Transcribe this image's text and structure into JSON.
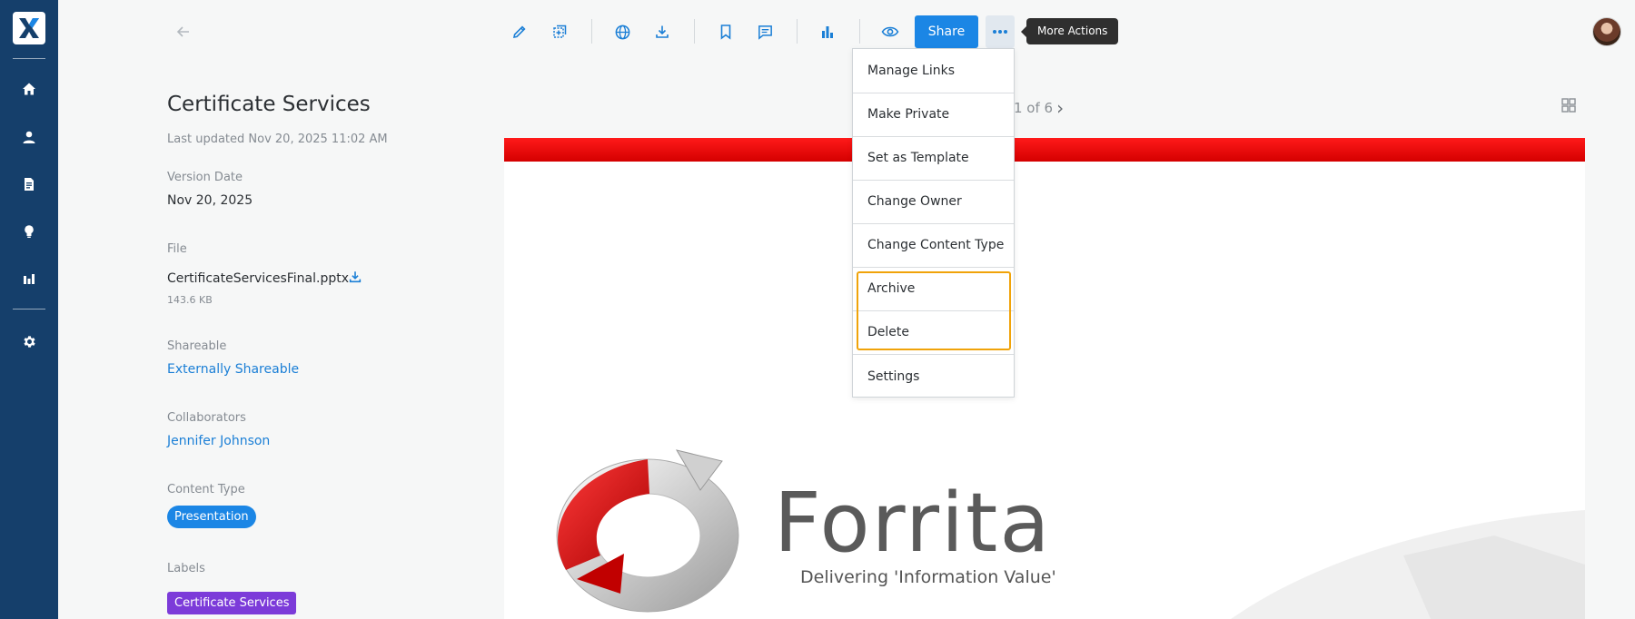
{
  "nav": {
    "logo_letter": "X",
    "items": [
      "home-icon",
      "user-icon",
      "document-icon",
      "lightbulb-icon",
      "bar-chart-icon",
      "gear-icon"
    ]
  },
  "toolbar": {
    "share_label": "Share",
    "more_tooltip": "More Actions",
    "icons": [
      "back-arrow-icon",
      "edit-icon",
      "copy-icon",
      "globe-icon",
      "download-icon",
      "bookmark-icon",
      "comment-icon",
      "stats-icon",
      "eye-icon",
      "more-icon"
    ]
  },
  "details": {
    "title": "Certificate Services",
    "last_updated": "Last updated Nov 20, 2025 11:02 AM",
    "version_date_label": "Version Date",
    "version_date": "Nov 20, 2025",
    "file_label": "File",
    "file_name": "CertificateServicesFinal.pptx",
    "file_size": "143.6 KB",
    "shareable_label": "Shareable",
    "shareable_value": "Externally Shareable",
    "collaborators_label": "Collaborators",
    "collaborator": "Jennifer Johnson",
    "content_type_label": "Content Type",
    "content_type": "Presentation",
    "labels_label": "Labels",
    "label": "Certificate Services"
  },
  "preview": {
    "pager": "1 of 6",
    "brand_name": "Forrita",
    "tagline": "Delivering 'Information Value'"
  },
  "menu": {
    "items": [
      "Manage Links",
      "Make Private",
      "Set as Template",
      "Change Owner",
      "Change Content Type",
      "Archive",
      "Delete",
      "Settings"
    ],
    "highlighted": [
      "Archive",
      "Delete"
    ]
  },
  "colors": {
    "nav_bg": "#153f6b",
    "accent": "#1b86e5",
    "label_purple": "#7c3bd9",
    "highlight": "#f0a30a",
    "brand_red": "#e00000"
  }
}
